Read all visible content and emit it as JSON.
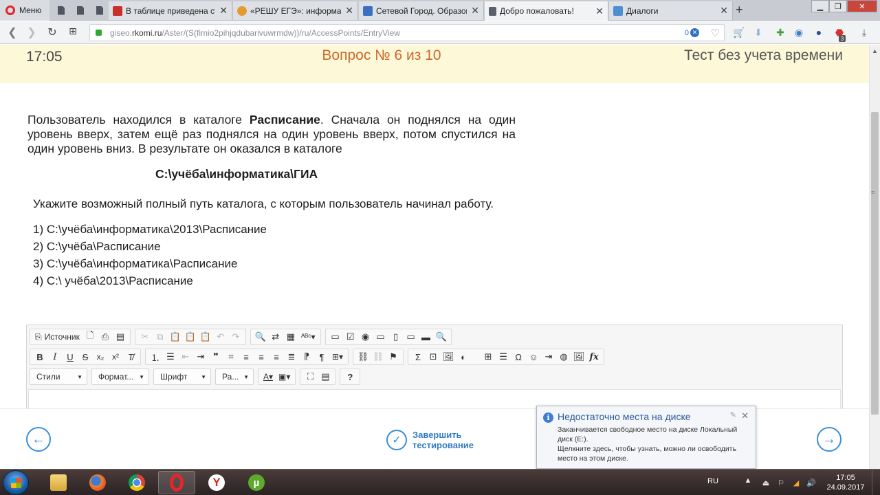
{
  "browser": {
    "menu_label": "Меню",
    "tabs": [
      {
        "title": "В таблице приведена сто",
        "active": false
      },
      {
        "title": "«РЕШУ ЕГЭ»: информатик",
        "active": false
      },
      {
        "title": "Сетевой Город. Образова",
        "active": false
      },
      {
        "title": "Добро пожаловать!",
        "active": true
      },
      {
        "title": "Диалоги",
        "active": false
      }
    ],
    "url": {
      "prefix": "giseo.",
      "host": "rkomi.ru",
      "path": "/Aster/(S(fimio2pihjqdubarivuwrmdw))/ru/AccessPoints/EntryView",
      "badge_count": "0"
    },
    "extension_badge": "3"
  },
  "page": {
    "clock": "17:05",
    "question_no": "Вопрос № 6 из 10",
    "test_mode": "Тест без учета времени"
  },
  "question": {
    "text_before": "Пользователь находился в каталоге ",
    "text_bold": "Расписание",
    "text_after": ". Сначала он поднялся на один уровень вверх, затем ещё раз поднялся на один уровень вверх, потом спустился на один уровень вниз. В результате он оказался в каталоге",
    "path": "С:\\учёба\\информатика\\ГИА",
    "task": "Укажите возможный полный путь каталога, с которым пользователь начинал работу.",
    "options": [
      "1) С:\\учёба\\информатика\\2013\\Расписание",
      "2) С:\\учёба\\Расписание",
      "3) С:\\учёба\\информатика\\Расписание",
      "4) С:\\  учёба\\2013\\Расписание"
    ]
  },
  "editor": {
    "source_label": "Источник",
    "styles_label": "Стили",
    "format_label": "Формат...",
    "font_label": "Шрифт",
    "size_label": "Ра...",
    "help_label": "?"
  },
  "nav": {
    "finish_label": "Завершить тестирование"
  },
  "notification": {
    "title": "Недостаточно места на диске",
    "body": "Заканчивается свободное место на диске Локальный диск (E:).",
    "hint": "Щелкните здесь, чтобы узнать, можно ли освободить место на этом диске."
  },
  "taskbar": {
    "lang": "RU",
    "time": "17:05",
    "date": "24.09.2017"
  },
  "colors": {
    "header_bg": "#fdf8d8",
    "question_no": "#c9692c",
    "accent": "#3a8dd8"
  }
}
